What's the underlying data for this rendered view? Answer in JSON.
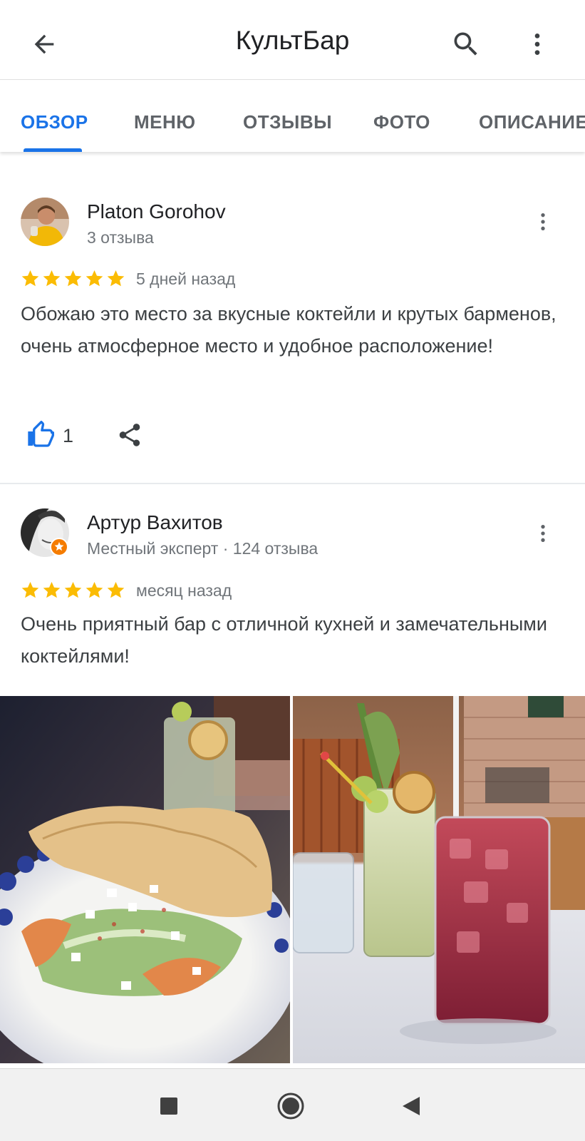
{
  "appbar": {
    "title": "КультБар",
    "back_icon": "arrow-left-icon",
    "search_icon": "search-icon",
    "more_icon": "more-vert-icon"
  },
  "tabs": [
    {
      "label": "ОБЗОР",
      "active": true
    },
    {
      "label": "МЕНЮ",
      "active": false
    },
    {
      "label": "ОТЗЫВЫ",
      "active": false
    },
    {
      "label": "ФОТО",
      "active": false
    },
    {
      "label": "ОПИСАНИЕ",
      "active": false
    }
  ],
  "reviews": [
    {
      "author": "Platon Gorohov",
      "meta": "3 отзыва",
      "rating": 5,
      "date": "5 дней назад",
      "text": "Обожаю это место за вкусные коктейли и крутых барменов, очень атмосферное место и удобное расположение!",
      "likes": "1"
    },
    {
      "author": "Артур Вахитов",
      "meta": "Местный эксперт · 124 отзыва",
      "local_guide_badge": true,
      "rating": 5,
      "date": "месяц назад",
      "text": "Очень приятный бар с отличной кухней и замечательными коктейлями!"
    }
  ],
  "photos": [
    {
      "subject": "salad-with-flatbread"
    },
    {
      "subject": "two-cocktails"
    }
  ],
  "navbar": {
    "recents_icon": "square-icon",
    "home_icon": "circle-icon",
    "back_icon": "triangle-back-icon"
  },
  "colors": {
    "accent": "#1a73e8",
    "star": "#fbbc04",
    "secondary_text": "#70757a",
    "local_guide_badge": "#f57c00"
  }
}
